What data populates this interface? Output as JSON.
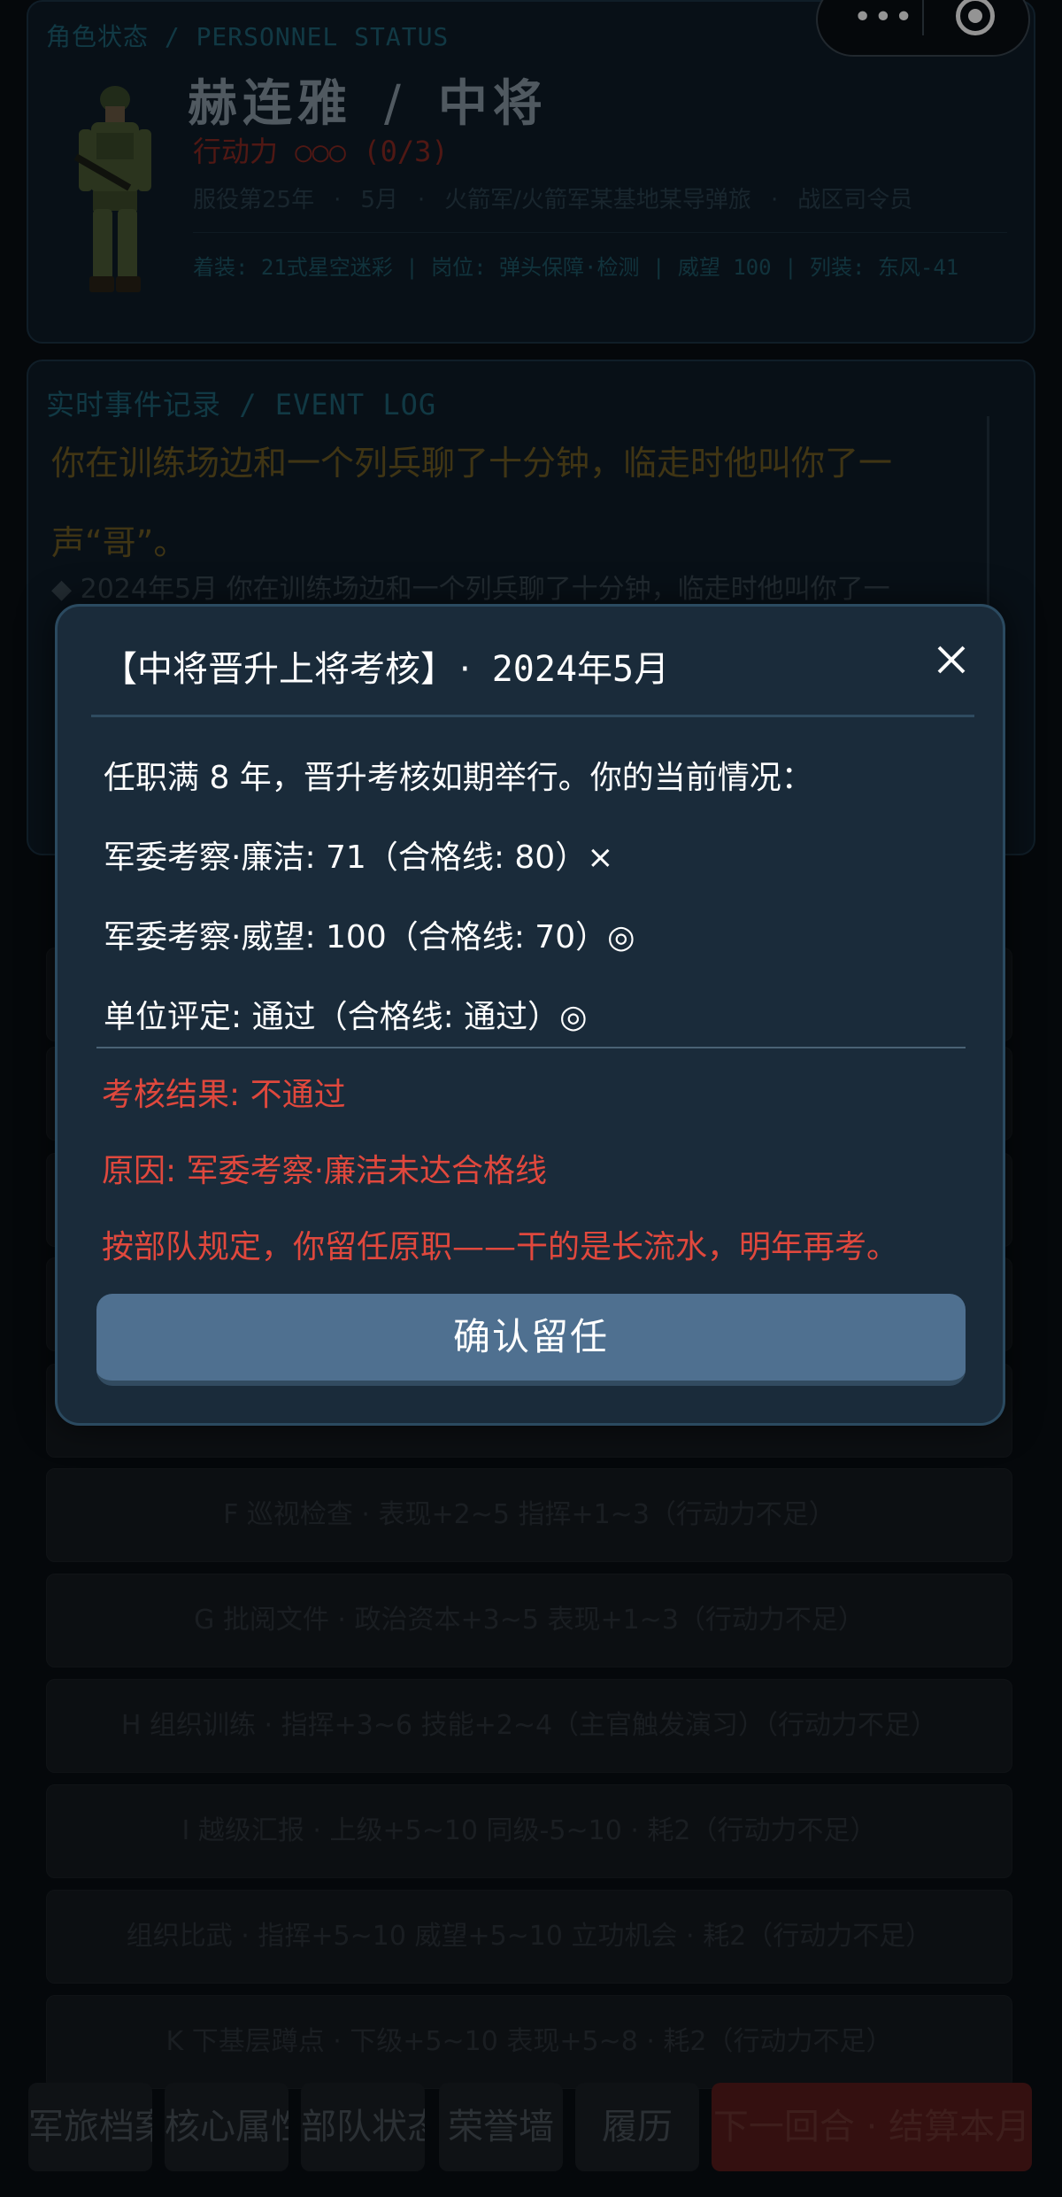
{
  "header_menu": {
    "more_icon": "more-dots-icon",
    "close_icon": "target-circle-icon"
  },
  "status": {
    "section_label": "角色状态 / PERSONNEL STATUS",
    "name": "赫连雅",
    "slash": "/",
    "rank": "中将",
    "action_points": "行动力 ○○○ (0/3)",
    "service_year": "服役第25年",
    "service_month": "5月",
    "unit": "火箭军/火箭军某基地某导弹旅",
    "role": "战区司令员",
    "dot": "·",
    "gear_line": "着装: 21式星空迷彩 | 岗位: 弹头保障·检测 | 威望 100 | 列装: 东风-41"
  },
  "event_log": {
    "section_label": "实时事件记录 / EVENT LOG",
    "highlight": "你在训练场边和一个列兵聊了十分钟，临走时他叫你了一声“哥”。",
    "entry": "◆ 2024年5月 你在训练场边和一个列兵聊了十分钟，临走时他叫你了一"
  },
  "actions": [
    {
      "label": "F  巡视检查  ·  表现+2~5 指挥+1~3（行动力不足）"
    },
    {
      "label": "G  批阅文件  ·  政治资本+3~5 表现+1~3（行动力不足）"
    },
    {
      "label": "H  组织训练  ·  指挥+3~6 技能+2~4（主官触发演习）（行动力不足）"
    },
    {
      "label": "I  越级汇报  ·  上级+5~10 同级-5~10  ·  耗2（行动力不足）"
    },
    {
      "label": "组织比武  ·  指挥+5~10 威望+5~10 立功机会  ·  耗2（行动力不足）"
    },
    {
      "label": "K  下基层蹲点  ·  下级+5~10 表现+5~8  ·  耗2（行动力不足）"
    }
  ],
  "tabs": [
    {
      "label": "军旅档案"
    },
    {
      "label": "核心属性"
    },
    {
      "label": "部队状态"
    },
    {
      "label": "荣誉墙"
    },
    {
      "label": "履历"
    },
    {
      "label": "下一回合  ·  结算本月"
    }
  ],
  "modal": {
    "title": "【中将晋升上将考核】",
    "dot": "·",
    "date": "2024年5月",
    "intro": "任职满 8 年，晋升考核如期举行。你的当前情况：",
    "criteria": [
      "军委考察·廉洁: 71（合格线: 80）×",
      "军委考察·威望: 100（合格线: 70）◎",
      "单位评定: 通过（合格线: 通过）◎"
    ],
    "result": "考核结果: 不通过",
    "reason": "原因: 军委考察·廉洁未达合格线",
    "note": "按部队规定，你留任原职——干的是长流水，明年再考。",
    "confirm": "确认留任"
  },
  "colors": {
    "accent_red": "#e0483d",
    "button_blue": "#4f7090",
    "modal_bg": "#1a2b3a"
  }
}
